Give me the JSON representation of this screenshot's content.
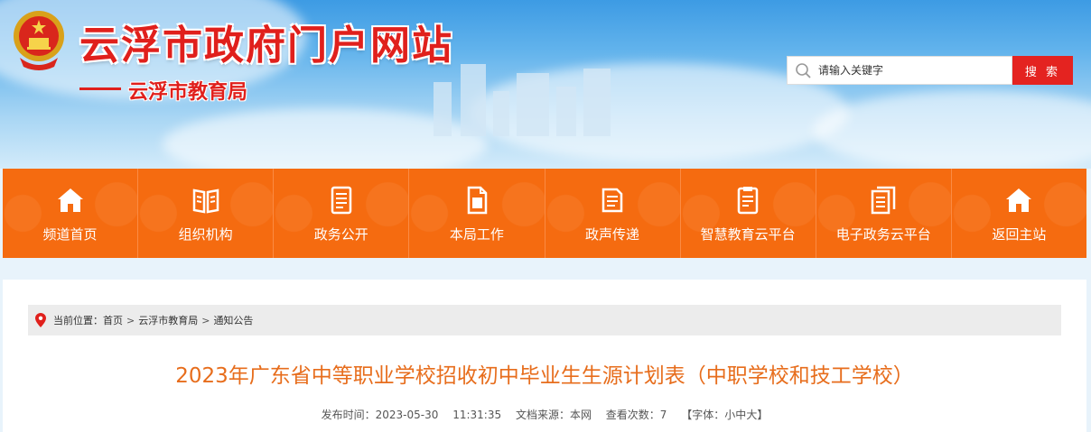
{
  "header": {
    "site_title": "云浮市政府门户网站",
    "sub_title": "云浮市教育局",
    "emblem_icon": "national-emblem-icon"
  },
  "search": {
    "placeholder": "请输入关键字",
    "button_label": "搜 索",
    "icon": "search-icon"
  },
  "nav": {
    "items": [
      {
        "label": "频道首页",
        "icon": "home-icon"
      },
      {
        "label": "组织机构",
        "icon": "book-icon"
      },
      {
        "label": "政务公开",
        "icon": "document-icon"
      },
      {
        "label": "本局工作",
        "icon": "file-icon"
      },
      {
        "label": "政声传递",
        "icon": "notice-icon"
      },
      {
        "label": "智慧教育云平台",
        "icon": "clipboard-icon"
      },
      {
        "label": "电子政务云平台",
        "icon": "pages-icon"
      },
      {
        "label": "返回主站",
        "icon": "home-icon"
      }
    ]
  },
  "breadcrumb": {
    "prefix": "当前位置：",
    "items": [
      "首页",
      "云浮市教育局",
      "通知公告"
    ],
    "separator": ">"
  },
  "article": {
    "title": "2023年广东省中等职业学校招收初中毕业生生源计划表（中职学校和技工学校）",
    "publish_label": "发布时间：2023-05-30",
    "publish_time": "11:31:35",
    "source": "文档来源：本网",
    "views": "查看次数：7",
    "font_prefix": "【字体：",
    "font_small": "小",
    "font_medium": "中",
    "font_large": "大",
    "font_suffix": "】"
  },
  "colors": {
    "brand_red": "#e0201c",
    "nav_orange": "#f56b10",
    "title_orange": "#e76d1c",
    "search_button": "#e42320"
  }
}
